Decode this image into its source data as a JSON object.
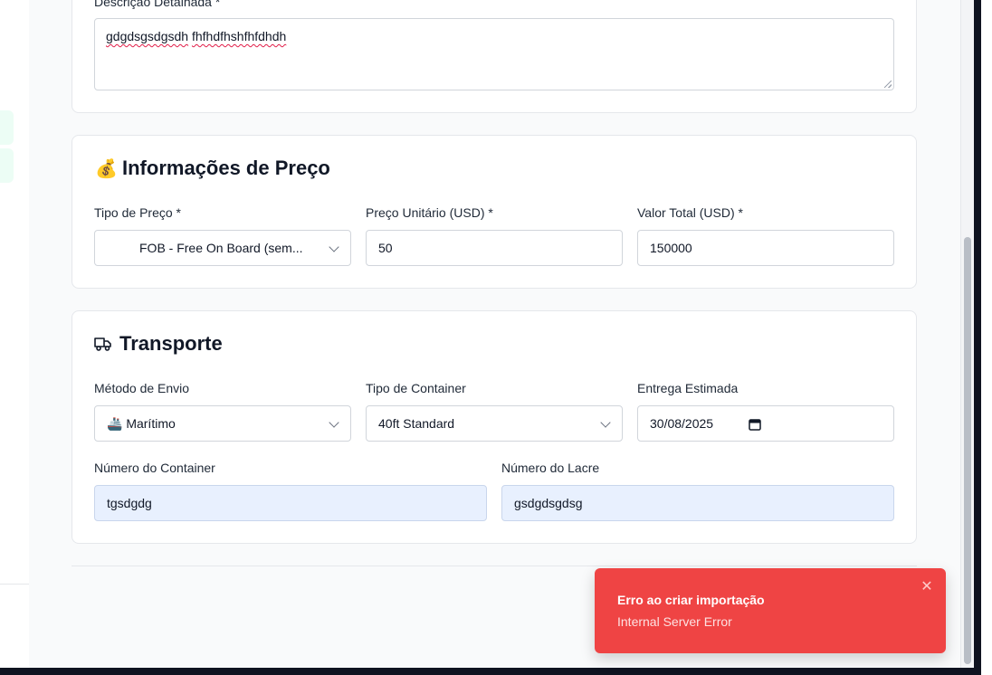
{
  "description": {
    "label": "Descrição Detalhada *",
    "value_part1": "gdgdsgsdgsdh",
    "value_part2": "fhfhdfhshfhfdhdh"
  },
  "price": {
    "title": "Informações de Preço",
    "title_icon": "💰",
    "price_type_label": "Tipo de Preço *",
    "price_type_value": "FOB - Free On Board (sem...",
    "unit_price_label": "Preço Unitário (USD) *",
    "unit_price_value": "50",
    "total_label": "Valor Total (USD) *",
    "total_value": "150000"
  },
  "transport": {
    "title": "Transporte",
    "shipping_method_label": "Método de Envio",
    "shipping_method_value": "🚢 Marítimo",
    "container_type_label": "Tipo de Container",
    "container_type_value": "40ft Standard",
    "delivery_label": "Entrega Estimada",
    "delivery_value": "30/08/2025",
    "container_number_label": "Número do Container",
    "container_number_value": "tgsdgdg",
    "seal_number_label": "Número do Lacre",
    "seal_number_value": "gsdgdsgdsg"
  },
  "toast": {
    "title": "Erro ao criar importação",
    "message": "Internal Server Error",
    "close_glyph": "✕"
  },
  "colors": {
    "error": "#ef4444",
    "filled_field": "#e8f0fe"
  }
}
